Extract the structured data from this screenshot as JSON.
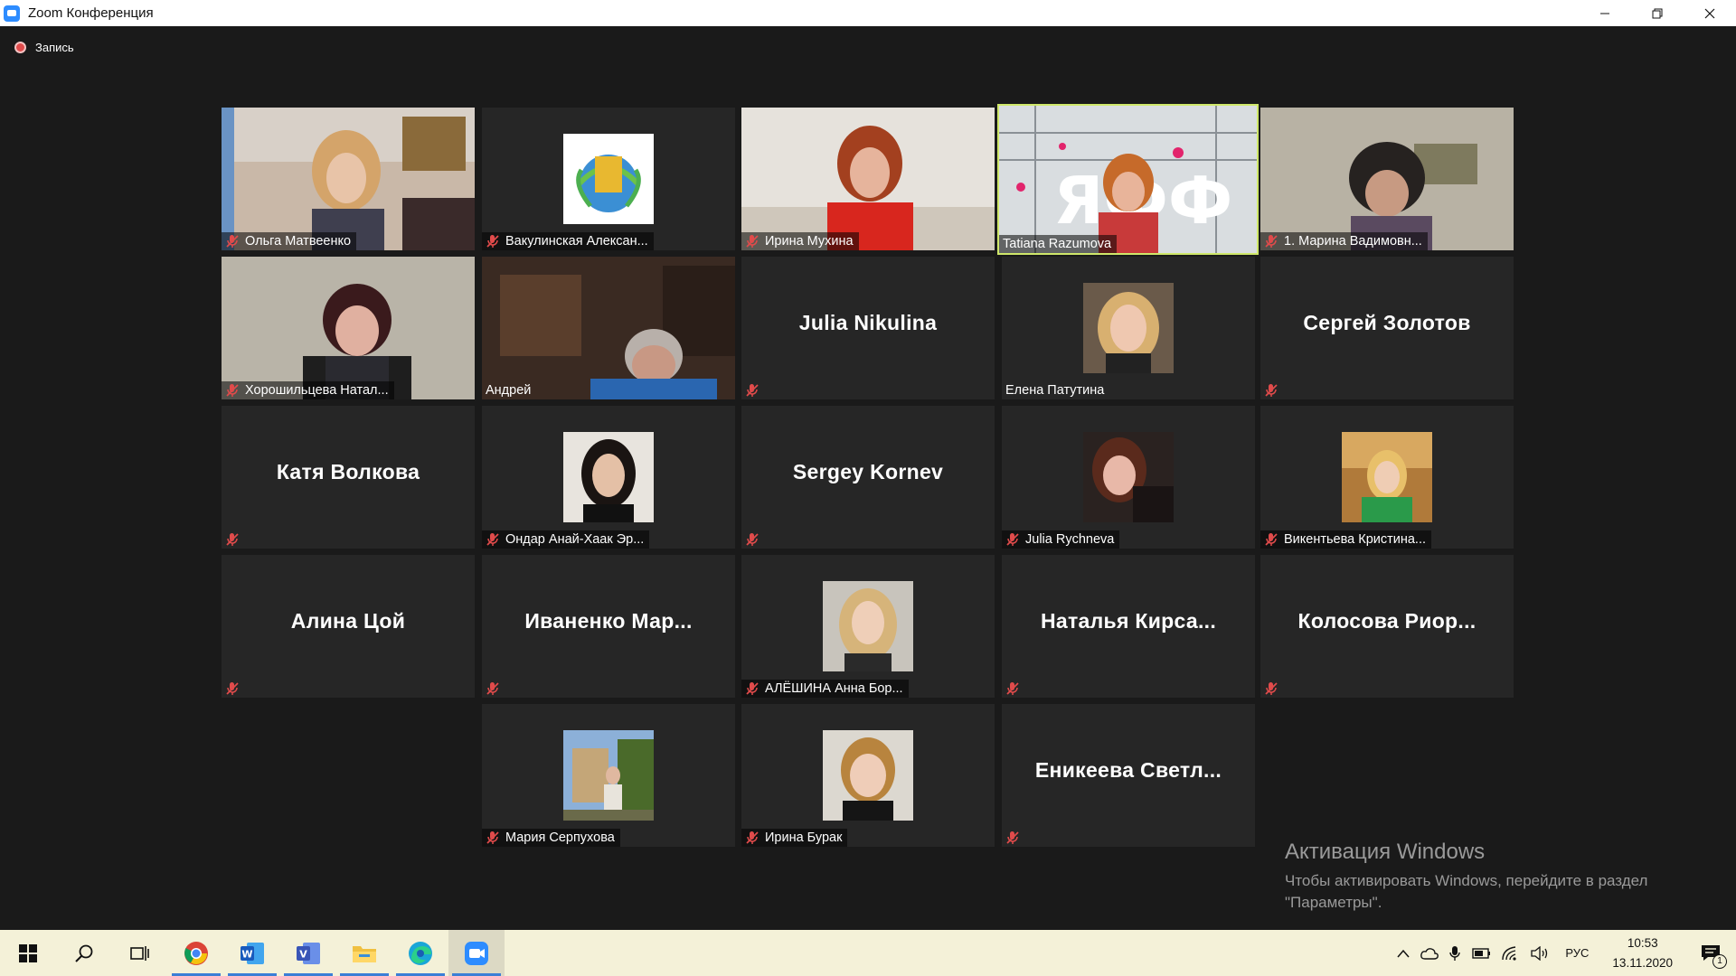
{
  "window": {
    "title": "Zoom Конференция",
    "minimize": "—",
    "restore": "❐",
    "close": "✕"
  },
  "recording": {
    "label": "Запись"
  },
  "colors": {
    "mute_icon": "#e04b4b",
    "speaker_border": "#cfe76a",
    "tile_bg": "#262626"
  },
  "participants": [
    {
      "name": "Ольга Матвеенко",
      "muted": true,
      "type": "video"
    },
    {
      "name": "Вакулинская Алексан...",
      "muted": true,
      "type": "avatar"
    },
    {
      "name": "Ирина Мухина",
      "muted": true,
      "type": "video"
    },
    {
      "name": "Tatiana Razumova",
      "muted": false,
      "type": "video",
      "speaking": true
    },
    {
      "name": "1. Марина Вадимовн...",
      "muted": true,
      "type": "video"
    },
    {
      "name": "Хорошильцева Натал...",
      "muted": true,
      "type": "video"
    },
    {
      "name": "Андрей",
      "muted": false,
      "type": "video"
    },
    {
      "name": "Julia Nikulina",
      "display": "Julia Nikulina",
      "muted": true,
      "type": "name"
    },
    {
      "name": "Елена Патутина",
      "muted": false,
      "type": "avatar"
    },
    {
      "name": "Сергей Золотов",
      "display": "Сергей Золотов",
      "muted": true,
      "type": "name"
    },
    {
      "name": "Катя Волкова",
      "display": "Катя Волкова",
      "muted": true,
      "type": "name"
    },
    {
      "name": "Ондар Анай-Хаак Эр...",
      "muted": true,
      "type": "avatar"
    },
    {
      "name": "Sergey Kornev",
      "display": "Sergey Kornev",
      "muted": true,
      "type": "name"
    },
    {
      "name": "Julia Rychneva",
      "muted": true,
      "type": "avatar"
    },
    {
      "name": "Викентьева Кристина...",
      "muted": true,
      "type": "avatar"
    },
    {
      "name": "Алина Цой",
      "display": "Алина Цой",
      "muted": true,
      "type": "name"
    },
    {
      "name": "Иваненко Мар...",
      "display": "Иваненко Мар...",
      "muted": true,
      "type": "name"
    },
    {
      "name": "АЛЁШИНА Анна Бор...",
      "muted": true,
      "type": "avatar"
    },
    {
      "name": "Наталья Кирса...",
      "display": "Наталья Кирса...",
      "muted": true,
      "type": "name"
    },
    {
      "name": "Колосова Риор...",
      "display": "Колосова Риор...",
      "muted": true,
      "type": "name"
    },
    {
      "name": "Мария Серпухова",
      "muted": true,
      "type": "avatar"
    },
    {
      "name": "Ирина Бурак",
      "muted": true,
      "type": "avatar"
    },
    {
      "name": "Еникеева Светл...",
      "display": "Еникеева Светл...",
      "muted": true,
      "type": "name"
    }
  ],
  "activation": {
    "title": "Активация Windows",
    "line1": "Чтобы активировать Windows, перейдите в раздел",
    "line2": "\"Параметры\"."
  },
  "taskbar": {
    "apps": [
      "start-icon",
      "search-icon",
      "task-view-icon",
      "chrome-icon",
      "word-icon",
      "visio-icon",
      "file-explorer-icon",
      "edge-icon",
      "zoom-icon"
    ],
    "language": "РУС",
    "time": "10:53",
    "date": "13.11.2020",
    "notification_count": "1"
  }
}
